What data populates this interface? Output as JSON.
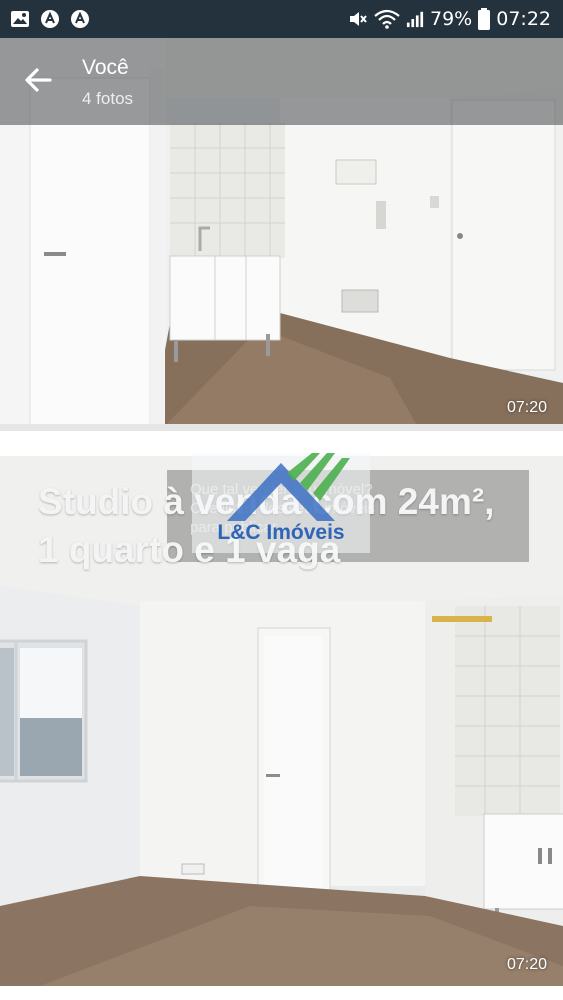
{
  "status_bar": {
    "battery_percent": "79%",
    "time": "07:22",
    "icons_left": [
      "gallery-icon",
      "app-icon",
      "app-icon"
    ],
    "icons_right": [
      "mute-icon",
      "wifi-icon",
      "signal-icon",
      "battery-icon"
    ]
  },
  "app_bar": {
    "title": "Você",
    "subtitle": "4 fotos"
  },
  "photos": [
    {
      "timestamp": "07:20"
    },
    {
      "timestamp": "07:20",
      "overlay_title_line1": "Studio à venda com 24m²,",
      "overlay_title_line2": "1 quarto e 1 vaga",
      "hint_line1": "Que tal vender seu imóvel?",
      "hint_line2": "Crie listas dos seus imóveis",
      "hint_line3": "para publicar",
      "logo_text": "L&C Imóveis"
    }
  ],
  "colors": {
    "status_bar": "#23323c",
    "app_bar_overlay": "rgba(70,72,74,0.55)",
    "logo_blue": "#2f65b9",
    "logo_green": "#4caf50"
  }
}
